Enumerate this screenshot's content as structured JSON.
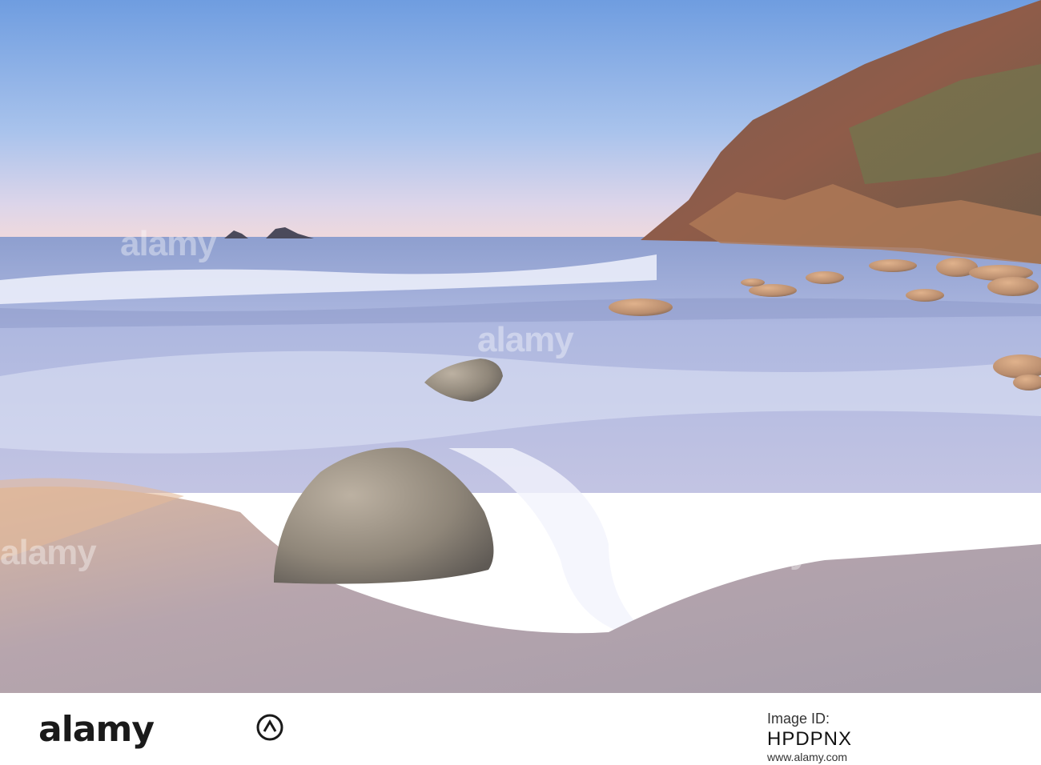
{
  "watermark": {
    "brand": "alamy",
    "image_id_label": "Image ID:",
    "image_id": "HPDPNX",
    "footer_url": "www.alamy.com"
  },
  "colors": {
    "sky_top": "#7aa6e0",
    "sky_horizon": "#e9d5e4",
    "sea": "#9aa9d4",
    "sand": "#b9a7a7",
    "cliff": "#8b5e4a",
    "foam": "#eef1fb"
  }
}
